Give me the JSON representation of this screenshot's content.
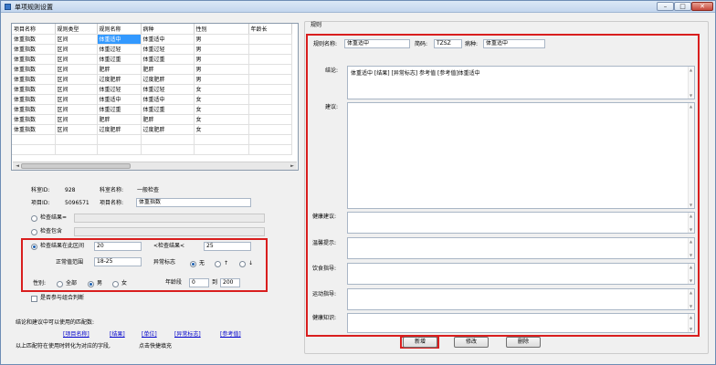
{
  "window": {
    "title": "单项规则设置",
    "minimize": "–",
    "maximize": "□",
    "close": "✕"
  },
  "grid": {
    "columns": [
      "项目名称",
      "规则类型",
      "规则名称",
      "病种",
      "性别",
      "年龄长"
    ],
    "rows": [
      [
        "体重指数",
        "区间",
        "体重适中",
        "体重适中",
        "男",
        ""
      ],
      [
        "体重指数",
        "区间",
        "体重过轻",
        "体重过轻",
        "男",
        ""
      ],
      [
        "体重指数",
        "区间",
        "体重过重",
        "体重过重",
        "男",
        ""
      ],
      [
        "体重指数",
        "区间",
        "肥胖",
        "肥胖",
        "男",
        ""
      ],
      [
        "体重指数",
        "区间",
        "过度肥胖",
        "过度肥胖",
        "男",
        ""
      ],
      [
        "体重指数",
        "区间",
        "体重过轻",
        "体重过轻",
        "女",
        ""
      ],
      [
        "体重指数",
        "区间",
        "体重适中",
        "体重适中",
        "女",
        ""
      ],
      [
        "体重指数",
        "区间",
        "体重过重",
        "体重过重",
        "女",
        ""
      ],
      [
        "体重指数",
        "区间",
        "肥胖",
        "肥胖",
        "女",
        ""
      ],
      [
        "体重指数",
        "区间",
        "过度肥胖",
        "过度肥胖",
        "女",
        ""
      ],
      [
        "",
        "",
        "",
        "",
        "",
        ""
      ],
      [
        "",
        "",
        "",
        "",
        "",
        ""
      ]
    ],
    "selected_row": 0,
    "scroll_left": "◄",
    "scroll_right": "►"
  },
  "left": {
    "dept_id_label": "科室ID:",
    "dept_id": "928",
    "dept_name_label": "科室名称:",
    "dept_name": "一般检查",
    "item_id_label": "项目ID:",
    "item_id": "5096571",
    "item_name_label": "项目名称:",
    "item_name": "体重指数",
    "opt_result_label": "检查结果=",
    "opt_abnormal_label": "检查包含",
    "opt_range_label": "检查结果在此区间",
    "range_low": "20",
    "range_op_label": "<检查结果<",
    "range_high": "25",
    "normal_range_label": "正常值范围",
    "normal_range": "18-25",
    "abnormal_flag_label": "异常标志",
    "abn_none": "无",
    "abn_up": "↑",
    "abn_down": "↓",
    "gender_label": "性别:",
    "gender_all": "全部",
    "gender_male": "男",
    "gender_female": "女",
    "age_label": "年龄段",
    "age_from": "0",
    "age_to_label": "到",
    "age_to": "200",
    "combo_label": "是否参与组合判断",
    "hint_vars": "结论和建议中可以使用的匹配数:",
    "links": [
      "[项目名称]",
      "[结果]",
      "[单位]",
      "[异常标志]",
      "[参考值]"
    ],
    "hint_abn": "以上匹配符在使用时转化为对应的字段,",
    "hint_click": "点击快捷填充"
  },
  "right": {
    "group_title": "规则",
    "rule_name_label": "规则名称:",
    "rule_name": "体重适中",
    "abbr_label": "简码:",
    "abbr": "TZSZ",
    "disease_label": "病种:",
    "disease": "体重适中",
    "conclusion_label": "结论:",
    "conclusion": "体重适中 [结果] [异常标志] 参考值 [参考值]体重适中",
    "advice_label": "建议:",
    "health_advice_label": "健康建议:",
    "warm_tips_label": "温馨提示:",
    "diet_label": "饮食指导:",
    "exercise_label": "运动指导:",
    "health_knowledge_label": "健康知识:"
  },
  "buttons": {
    "add": "新增",
    "edit": "修改",
    "delete": "删除"
  },
  "colors": {
    "highlight": "#d91e1e",
    "selection": "#3399ff"
  }
}
